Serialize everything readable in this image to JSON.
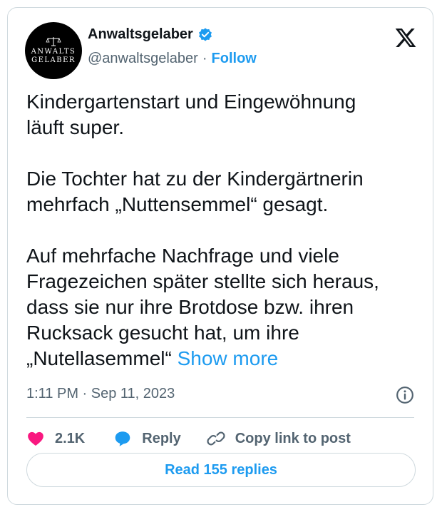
{
  "author": {
    "display_name": "Anwaltsgelaber",
    "handle": "@anwaltsgelaber",
    "separator": "·",
    "follow_label": "Follow",
    "avatar_text_line1": "ANWALTS",
    "avatar_text_line2": "GELABER",
    "verified_color": "#1d9bf0"
  },
  "tweet": {
    "paragraphs": [
      "Kindergartenstart und Eingewöhnung\nläuft super.",
      "Die Tochter hat zu der Kindergärtnerin\nmehrfach „Nuttensemmel“ gesagt.",
      "Auf mehrfache Nachfrage und viele\nFragezeichen später stellte sich heraus,\ndass sie nur ihre Brotdose bzw. ihren\nRucksack gesucht hat, um ihre\n„Nutellasemmel“ "
    ],
    "show_more_label": "Show more",
    "timestamp": "1:11 PM · Sep 11, 2023"
  },
  "actions": {
    "likes_count": "2.1K",
    "reply_label": "Reply",
    "copy_link_label": "Copy link to post"
  },
  "read_replies_label": "Read 155 replies",
  "colors": {
    "accent": "#1d9bf0",
    "like": "#f91880",
    "text": "#0f1419",
    "secondary": "#536471",
    "border": "#cfd9de"
  },
  "icons": [
    "scale-icon",
    "verified-badge-icon",
    "x-logo-icon",
    "info-icon",
    "heart-icon",
    "reply-bubble-icon",
    "link-icon"
  ]
}
